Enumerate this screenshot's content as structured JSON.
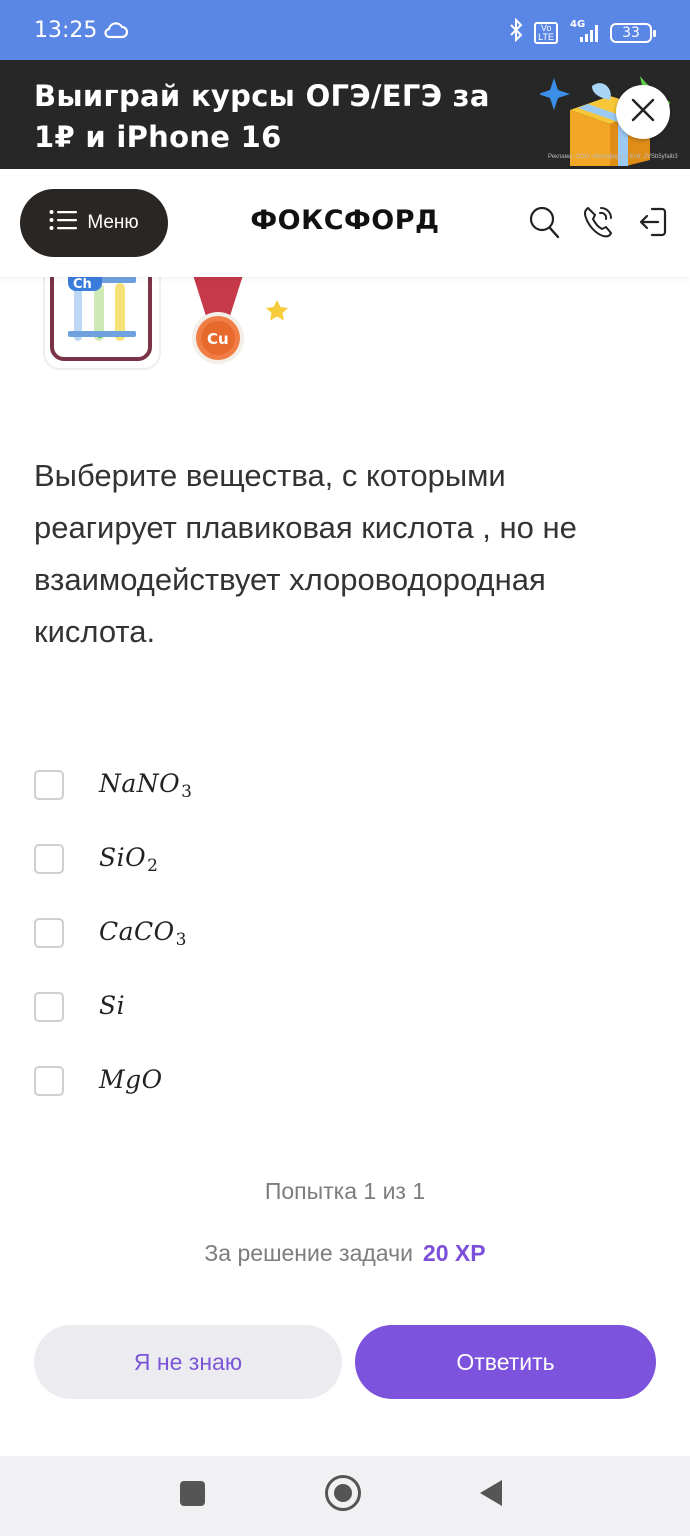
{
  "status_bar": {
    "time": "13:25",
    "network": "4G",
    "volte": "Vo LTE",
    "battery": "33",
    "icons": [
      "cloud-icon",
      "bluetooth-icon",
      "signal-icon",
      "battery-icon"
    ]
  },
  "banner": {
    "text": "Выиграй курсы ОГЭ/ЕГЭ за 1₽ и iPhone 16",
    "legal": "Реклама. ООО «Фоксфорд». Erid: 2VSb5yfaib3",
    "close_icon": "close-icon"
  },
  "header": {
    "menu_label": "Меню",
    "logo": "ФОКСФОРД",
    "icons": [
      "search-icon",
      "phone-icon",
      "login-icon"
    ]
  },
  "badges": {
    "chem_label": "Ch",
    "medal_label": "Cu"
  },
  "task": {
    "question": "Выберите вещества, с которыми реагирует плавиковая кислота , но не взаимодействует хлороводородная кислота.",
    "options": [
      {
        "base": "NaNO",
        "sub": "3",
        "checked": false
      },
      {
        "base": "SiO",
        "sub": "2",
        "checked": false
      },
      {
        "base": "CaCO",
        "sub": "3",
        "checked": false
      },
      {
        "base": "Si",
        "sub": "",
        "checked": false
      },
      {
        "base": "MgO",
        "sub": "",
        "checked": false
      }
    ],
    "attempt_text": "Попытка 1 из 1",
    "reward_text": "За решение задачи",
    "reward_xp": "20 XP"
  },
  "actions": {
    "dunno_label": "Я не знаю",
    "answer_label": "Ответить"
  },
  "colors": {
    "statusbar": "#5a86e6",
    "banner_bg": "#272727",
    "accent": "#7d52dc",
    "menu_bg": "#2a2623"
  }
}
